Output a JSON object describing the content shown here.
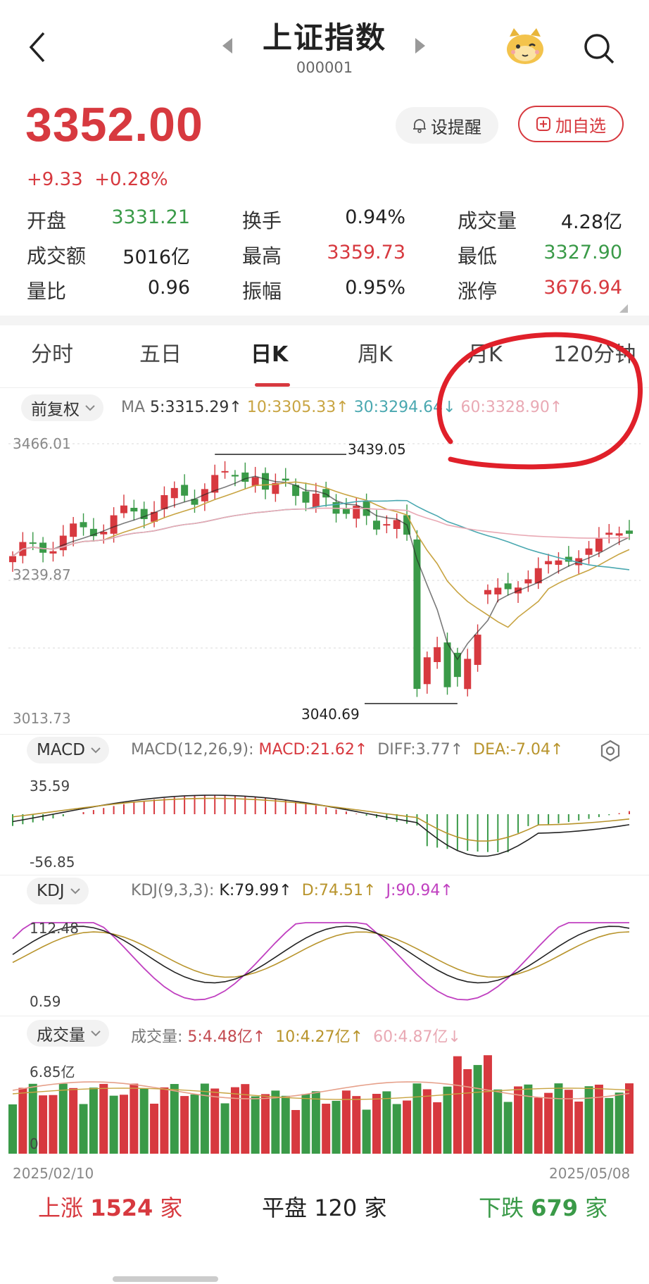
{
  "header": {
    "title": "上证指数",
    "code": "000001",
    "back_icon": "chevron-left-icon",
    "search_icon": "search-icon",
    "mascot_icon": "mascot-icon"
  },
  "quote": {
    "price": "3352.00",
    "change": "+9.33",
    "change_pct": "+0.28%",
    "alert_label": "设提醒",
    "watchlist_label": "加自选"
  },
  "stats": [
    {
      "label": "开盘",
      "value": "3331.21",
      "color": "green"
    },
    {
      "label": "换手",
      "value": "0.94%",
      "color": "black"
    },
    {
      "label": "成交量",
      "value": "4.28亿",
      "color": "black"
    },
    {
      "label": "成交额",
      "value": "5016亿",
      "color": "black"
    },
    {
      "label": "最高",
      "value": "3359.73",
      "color": "red"
    },
    {
      "label": "最低",
      "value": "3327.90",
      "color": "green"
    },
    {
      "label": "量比",
      "value": "0.96",
      "color": "black"
    },
    {
      "label": "振幅",
      "value": "0.95%",
      "color": "black"
    },
    {
      "label": "涨停",
      "value": "3676.94",
      "color": "red"
    }
  ],
  "tabs": [
    "分时",
    "五日",
    "日K",
    "周K",
    "月K",
    "120分钟"
  ],
  "active_tab": "日K",
  "kline": {
    "adjust_label": "前复权",
    "ma_label": "MA",
    "ma5": "5:3315.29↑",
    "ma10": "10:3305.33↑",
    "ma30": "30:3294.64↓",
    "ma60": "60:3328.90↑",
    "y_top": "3466.01",
    "y_mid": "3239.87",
    "y_bottom": "3013.73",
    "high_mark": "3439.05",
    "low_mark": "3040.69"
  },
  "macd": {
    "pill": "MACD",
    "params": "MACD(12,26,9):",
    "macd": "MACD:21.62↑",
    "diff": "DIFF:3.77↑",
    "dea": "DEA:-7.04↑",
    "y_top": "35.59",
    "y_bottom": "-56.85"
  },
  "kdj": {
    "pill": "KDJ",
    "params": "KDJ(9,3,3):",
    "k": "K:79.99↑",
    "d": "D:74.51↑",
    "j": "J:90.94↑",
    "y_top": "112.48",
    "y_bottom": "0.59"
  },
  "volume": {
    "pill": "成交量",
    "label": "成交量:",
    "v5": "5:4.48亿↑",
    "v10": "10:4.27亿↑",
    "v60": "60:4.87亿↓",
    "y_top": "6.85亿",
    "y_bottom": "0"
  },
  "dates": {
    "start": "2025/02/10",
    "end": "2025/05/08"
  },
  "market": {
    "up_label": "上涨",
    "up_count": "1524",
    "up_unit": "家",
    "flat_label": "平盘",
    "flat_count": "120",
    "flat_unit": "家",
    "down_label": "下跌",
    "down_count": "679",
    "down_unit": "家"
  },
  "colors": {
    "up": "#d7393f",
    "down": "#3a9a48",
    "ma5": "#222222",
    "ma10": "#c8a442",
    "ma30": "#4aa8b0",
    "ma60": "#e9a9b4",
    "kdj_j": "#c040c0"
  }
}
